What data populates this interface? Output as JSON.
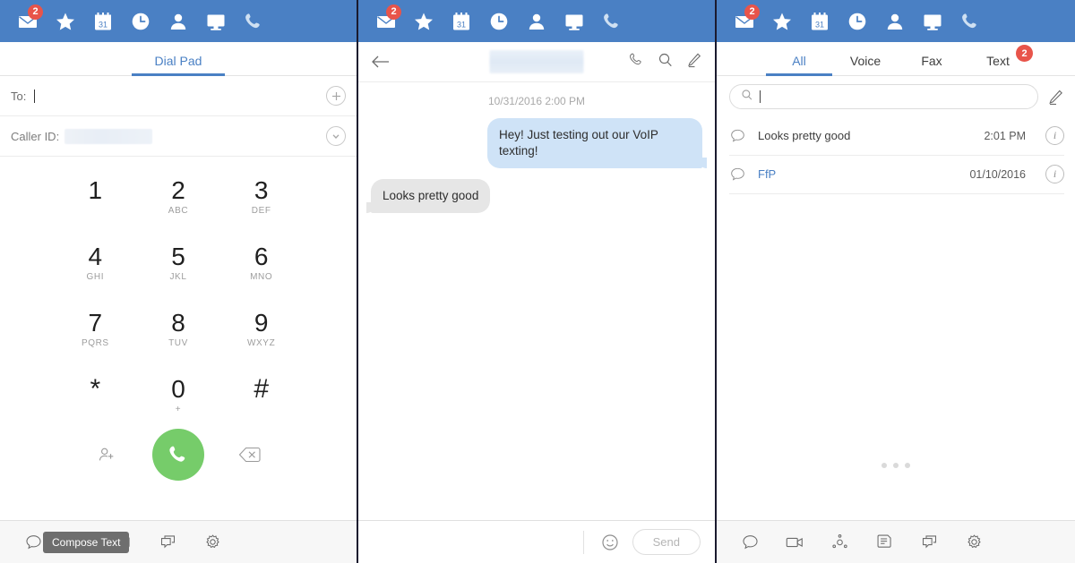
{
  "topbar": {
    "color": "#4a80c4",
    "badge_color": "#e8544a",
    "icons": [
      {
        "name": "mail-icon",
        "badge": "2"
      },
      {
        "name": "star-icon",
        "badge": ""
      },
      {
        "name": "calendar-icon",
        "badge": ""
      },
      {
        "name": "clock-icon",
        "badge": ""
      },
      {
        "name": "contact-icon",
        "badge": ""
      },
      {
        "name": "monitor-icon",
        "badge": ""
      },
      {
        "name": "phone-icon",
        "badge": ""
      }
    ],
    "calendar_day": "31"
  },
  "dialpad_panel": {
    "tab_label": "Dial Pad",
    "to_label": "To:",
    "to_value": "",
    "to_add_icon": "plus-circle-icon",
    "caller_id_label": "Caller ID:",
    "caller_id_value": "",
    "caller_id_icon": "chevron-down-circle-icon",
    "keys": [
      {
        "digit": "1",
        "sub": ""
      },
      {
        "digit": "2",
        "sub": "ABC"
      },
      {
        "digit": "3",
        "sub": "DEF"
      },
      {
        "digit": "4",
        "sub": "GHI"
      },
      {
        "digit": "5",
        "sub": "JKL"
      },
      {
        "digit": "6",
        "sub": "MNO"
      },
      {
        "digit": "7",
        "sub": "PQRS"
      },
      {
        "digit": "8",
        "sub": "TUV"
      },
      {
        "digit": "9",
        "sub": "WXYZ"
      },
      {
        "digit": "*",
        "sub": ""
      },
      {
        "digit": "0",
        "sub": "+"
      },
      {
        "digit": "#",
        "sub": ""
      }
    ],
    "add_contact_icon": "add-contact-icon",
    "call_button_icon": "phone-icon",
    "call_button_color": "#76cc6a",
    "backspace_icon": "backspace-icon",
    "tooltip": "Compose Text",
    "bottom_icons": [
      "chat-bubble-icon",
      "conference-icon",
      "fax-document-icon",
      "multi-window-icon",
      "gear-icon"
    ]
  },
  "conversation_panel": {
    "back_icon": "back-arrow-icon",
    "title": "",
    "actions": [
      "phone-icon",
      "search-icon",
      "compose-pencil-icon"
    ],
    "timestamp": "10/31/2016 2:00 PM",
    "messages": [
      {
        "direction": "out",
        "text": "Hey! Just testing out our VoIP texting!"
      },
      {
        "direction": "in",
        "text": "Looks pretty good"
      }
    ],
    "emoji_icon": "emoji-smiley-icon",
    "send_label": "Send"
  },
  "list_panel": {
    "tabs": [
      {
        "label": "All",
        "active": true,
        "badge": ""
      },
      {
        "label": "Voice",
        "active": false,
        "badge": ""
      },
      {
        "label": "Fax",
        "active": false,
        "badge": ""
      },
      {
        "label": "Text",
        "active": false,
        "badge": "2"
      }
    ],
    "search_placeholder": "",
    "search_value": "",
    "search_icon": "search-icon",
    "compose_icon": "compose-pencil-icon",
    "items": [
      {
        "icon": "chat-bubble-icon",
        "name": "",
        "preview": "Looks pretty good",
        "unread": false,
        "time": "2:01 PM",
        "info_icon": "info-icon"
      },
      {
        "icon": "chat-bubble-icon",
        "name": "",
        "preview": "FfP",
        "unread": true,
        "time": "01/10/2016",
        "info_icon": "info-icon"
      }
    ],
    "loading_dots": 3,
    "bottom_icons": [
      "chat-bubble-icon",
      "video-camera-icon",
      "conference-icon",
      "fax-document-icon",
      "multi-window-icon",
      "gear-icon"
    ]
  }
}
